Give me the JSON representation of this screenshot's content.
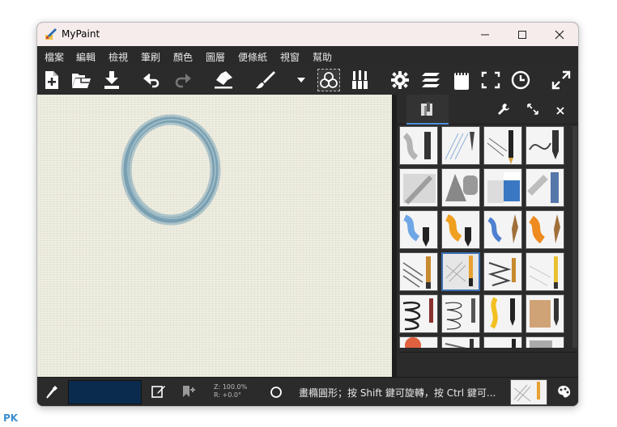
{
  "window": {
    "title": "MyPaint"
  },
  "menu": [
    "檔案",
    "編輯",
    "檢視",
    "筆刷",
    "顏色",
    "圖層",
    "便條紙",
    "視窗",
    "幫助"
  ],
  "toolbar": {
    "icons": [
      "new-file-icon",
      "open-file-icon",
      "save-icon",
      "undo-icon",
      "redo-icon",
      "eraser-icon",
      "brush-icon",
      "brush-dropdown-icon",
      "brush-modes-icon",
      "brush-group-icon",
      "settings-icon",
      "layers-icon",
      "scratchpad-icon",
      "fullscreen-icon",
      "history-icon",
      "expand-icon"
    ]
  },
  "colors": {
    "current_color": "#0b2b4e",
    "accent": "#4a90d9",
    "ring": "#6f9ab0"
  },
  "status": {
    "zoom": "Z: 100.0%",
    "rotation": "R: +0.0°",
    "message": "畫橢圓形；按 Shift 鍵可旋轉，按 Ctrl 鍵可..."
  },
  "watermark": "PK"
}
